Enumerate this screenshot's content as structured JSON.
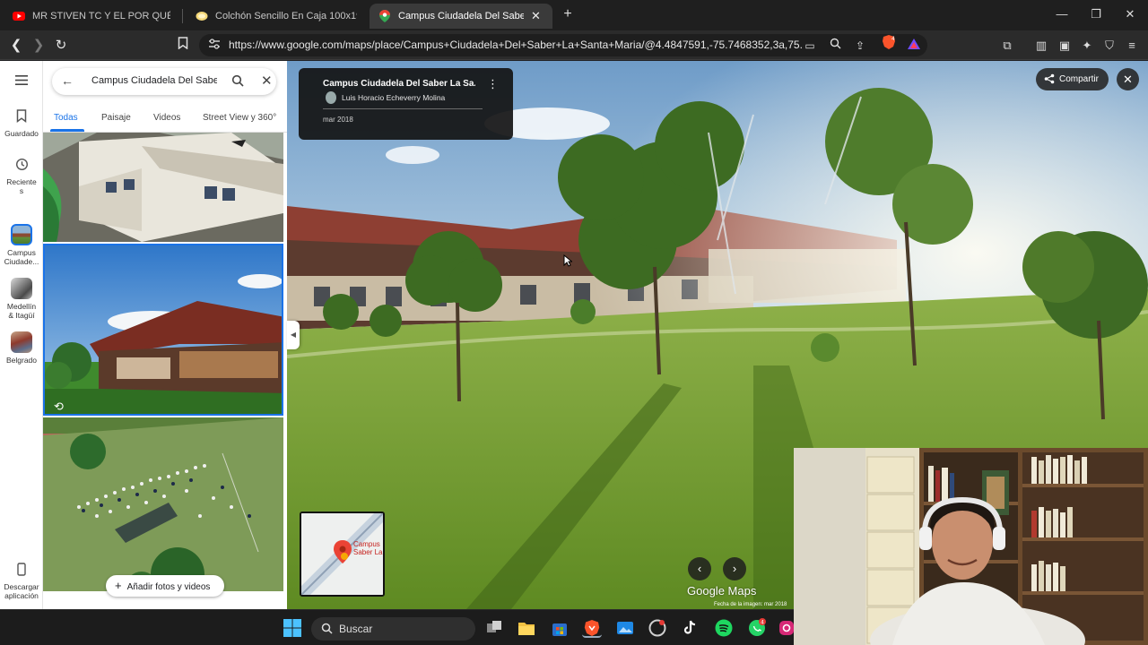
{
  "browser": {
    "tabs": [
      {
        "label": "MR STIVEN TC Y EL POR QUÉ NO SE",
        "icon": "youtube-icon"
      },
      {
        "label": "Colchón Sencillo En Caja 100x190 Fib",
        "icon": "store-icon"
      },
      {
        "label": "Campus Ciudadela Del Saber La",
        "icon": "maps-pin-icon",
        "active": true
      }
    ],
    "url": "https://www.google.com/maps/place/Campus+Ciudadela+Del+Saber+La+Santa+Maria/@4.4847591,-75.7468352,3a,75...",
    "brave_badge": "4"
  },
  "maps": {
    "search_query": "Campus Ciudadela Del Saber",
    "filters": [
      "Todas",
      "Paisaje",
      "Videos",
      "Street View y 360°"
    ],
    "rail": {
      "saved": "Guardado",
      "recent": "Reciente s",
      "places": [
        "Campus Ciudade...",
        "Medellín & Itagüí",
        "Belgrado"
      ],
      "download": "Descargar aplicación"
    },
    "add_photos": "Añadir fotos y videos"
  },
  "streetview": {
    "title": "Campus Ciudadela Del Saber La Sa...",
    "author": "Luis Horacio Echeverry Molina",
    "date": "mar 2018",
    "share": "Compartir",
    "minimap_label": "Campus Saber La",
    "watermark": "Google Maps",
    "image_date": "Fecha de la imagen: mar 2018"
  },
  "taskbar": {
    "search_label": "Buscar",
    "whatsapp_badge": "4"
  }
}
